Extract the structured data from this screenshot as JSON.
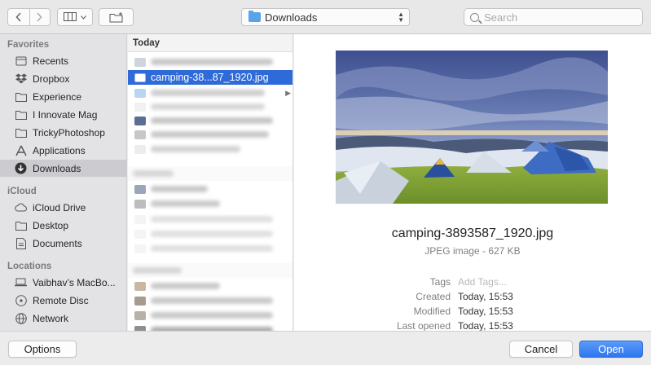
{
  "toolbar": {
    "back_icon": "chevron-left-icon",
    "forward_icon": "chevron-right-icon",
    "view_icon": "columns-view-icon",
    "new_folder_icon": "new-folder-icon",
    "location": "Downloads",
    "search_placeholder": "Search"
  },
  "sidebar": {
    "sections": [
      {
        "title": "Favorites",
        "items": [
          {
            "label": "Recents",
            "icon": "clock-icon"
          },
          {
            "label": "Dropbox",
            "icon": "dropbox-icon"
          },
          {
            "label": "Experience",
            "icon": "folder-icon"
          },
          {
            "label": "I Innovate Mag",
            "icon": "folder-icon"
          },
          {
            "label": "TrickyPhotoshop",
            "icon": "folder-icon"
          },
          {
            "label": "Applications",
            "icon": "applications-icon"
          },
          {
            "label": "Downloads",
            "icon": "download-icon",
            "selected": true
          }
        ]
      },
      {
        "title": "iCloud",
        "items": [
          {
            "label": "iCloud Drive",
            "icon": "cloud-icon"
          },
          {
            "label": "Desktop",
            "icon": "desktop-icon"
          },
          {
            "label": "Documents",
            "icon": "document-icon"
          }
        ]
      },
      {
        "title": "Locations",
        "items": [
          {
            "label": "Vaibhav’s MacBo...",
            "icon": "laptop-icon"
          },
          {
            "label": "Remote Disc",
            "icon": "disc-icon"
          },
          {
            "label": "Network",
            "icon": "network-icon"
          }
        ]
      }
    ]
  },
  "files": {
    "group_today": "Today",
    "selected_file": "camping-38...87_1920.jpg"
  },
  "preview": {
    "filename": "camping-3893587_1920.jpg",
    "kind": "JPEG image - 627 KB",
    "tags_label": "Tags",
    "tags_placeholder": "Add Tags...",
    "created_label": "Created",
    "created_value": "Today, 15:53",
    "modified_label": "Modified",
    "modified_value": "Today, 15:53",
    "opened_label": "Last opened",
    "opened_value": "Today, 15:53"
  },
  "footer": {
    "options_label": "Options",
    "cancel_label": "Cancel",
    "open_label": "Open"
  },
  "colors": {
    "selection": "#2f6bd8",
    "primary_button": "#2f76f0",
    "sidebar_bg": "#e3e3e6"
  }
}
